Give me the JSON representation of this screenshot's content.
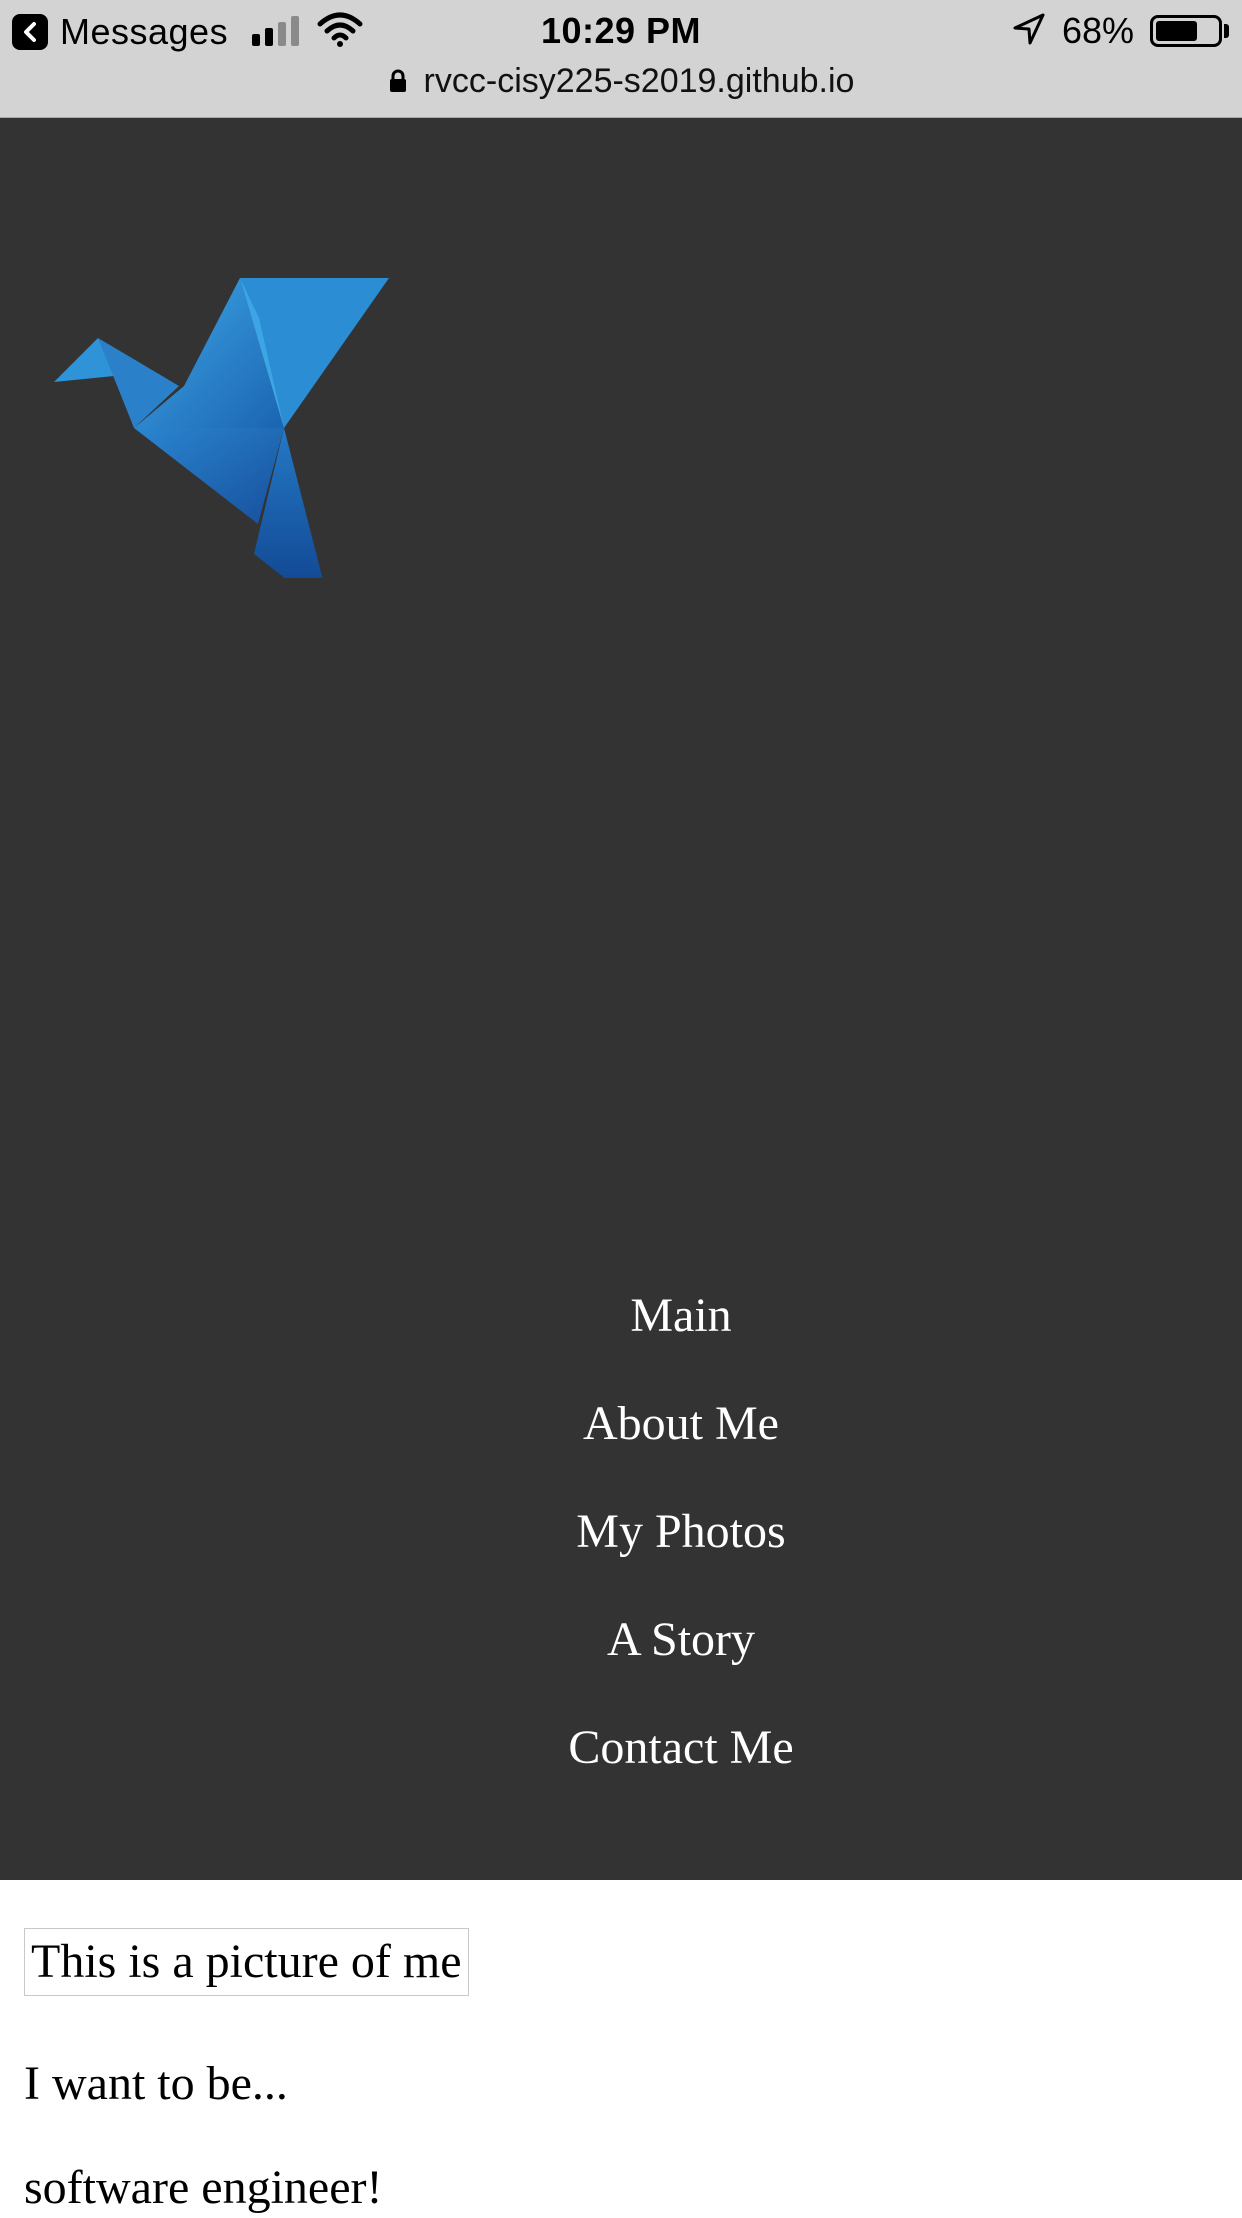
{
  "status_bar": {
    "back_app": "Messages",
    "time": "10:29 PM",
    "battery_percent": "68%",
    "battery_level": 0.68,
    "url": "rvcc-cisy225-s2019.github.io"
  },
  "header": {
    "logo": "origami-bird-logo",
    "nav": [
      {
        "label": "Main"
      },
      {
        "label": "About Me"
      },
      {
        "label": "My Photos"
      },
      {
        "label": "A Story"
      },
      {
        "label": "Contact Me"
      }
    ],
    "background_color": "#333333"
  },
  "content": {
    "picture_alt": "This is a picture of me",
    "lines": [
      "I want to be...",
      "software engineer!"
    ]
  }
}
